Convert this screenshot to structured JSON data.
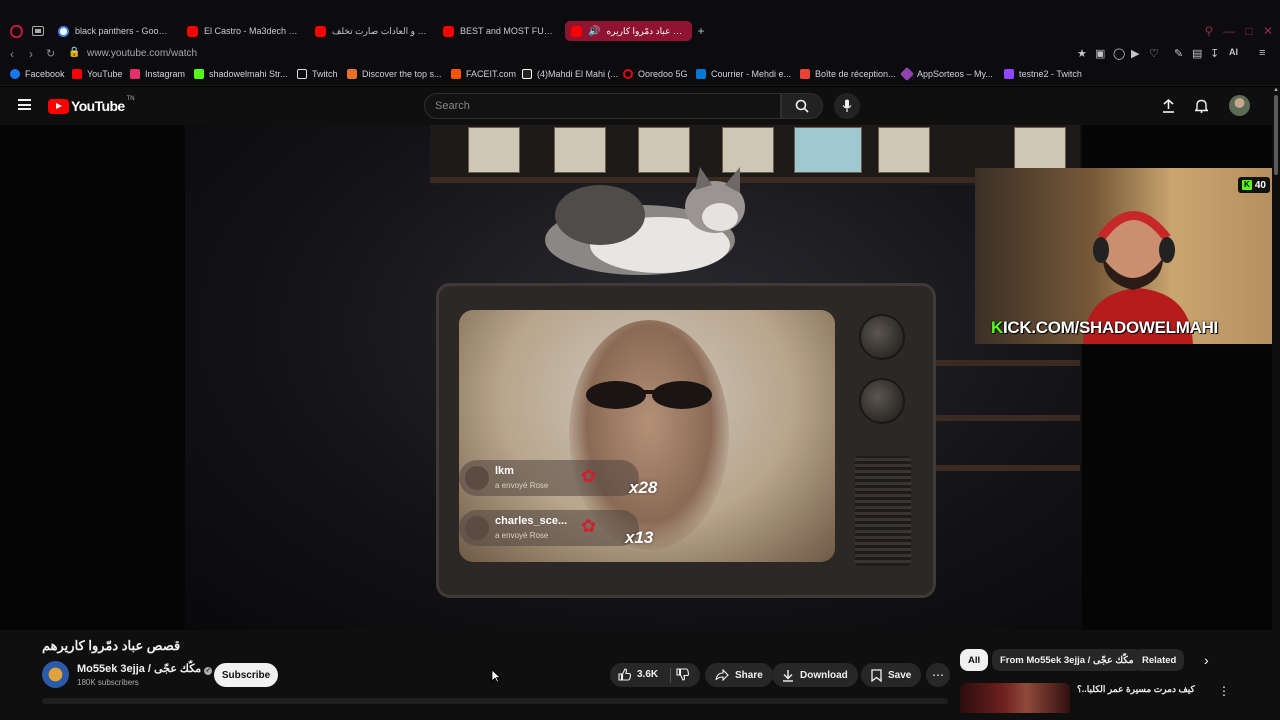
{
  "browser": {
    "tabs": [
      {
        "label": "black panthers - Google S",
        "color": "#4285f4"
      },
      {
        "label": "El Castro - Ma3dech mna",
        "color": "#ff0000"
      },
      {
        "label": "الدين و العادات صارت تخلف",
        "color": "#ff0000"
      },
      {
        "label": "BEST and MOST FUNNY",
        "color": "#ff0000"
      },
      {
        "label": "قصص عباد دمّروا كاريره",
        "color": "#ff0000"
      }
    ],
    "url": "www.youtube.com/watch",
    "bookmarks": [
      {
        "label": "Facebook",
        "color": "#1877f2"
      },
      {
        "label": "YouTube",
        "color": "#ff0000"
      },
      {
        "label": "Instagram",
        "color": "#e1306c"
      },
      {
        "label": "shadowelmahi Str...",
        "color": "#53fc18"
      },
      {
        "label": "Twitch",
        "color": "#9146ff"
      },
      {
        "label": "Discover the top s...",
        "color": "#e8712b"
      },
      {
        "label": "FACEIT.com",
        "color": "#ff5500"
      },
      {
        "label": "(4)Mahdi El Mahi (...",
        "color": "#ffffff"
      },
      {
        "label": "Ooredoo 5G",
        "color": "#e30613"
      },
      {
        "label": "Courrier - Mehdi e...",
        "color": "#0078d4"
      },
      {
        "label": "Boîte de réception...",
        "color": "#ea4335"
      },
      {
        "label": "AppSorteos – My...",
        "color": "#8e44ad"
      },
      {
        "label": "testne2 - Twitch",
        "color": "#9146ff"
      }
    ],
    "ai_label": "AI"
  },
  "youtube": {
    "logo_text": "YouTube",
    "logo_suffix": "TN",
    "search_placeholder": "Search",
    "video": {
      "gifts": [
        {
          "name": "lkm",
          "sub": "a envoyé Rose",
          "count": "x28"
        },
        {
          "name": "charles_sce...",
          "sub": "a envoyé Rose",
          "count": "x13"
        }
      ],
      "cam_badge": "40",
      "kick_prefix": "K",
      "kick_text": "ICK.COM/SHADOWELMAHI"
    },
    "title": "قصص عباد دمّروا كاريرهم",
    "channel": {
      "name": "Mo55ek 3ejja / مكّك عجّى",
      "subscribers": "180K subscribers",
      "subscribe_label": "Subscribe"
    },
    "actions": {
      "likes": "3.6K",
      "share": "Share",
      "download": "Download",
      "save": "Save"
    },
    "chips": [
      "All",
      "From Mo55ek 3ejja / مكّك عجّى",
      "Related"
    ],
    "recommendation_title": "كيف دمرت مسيرة عمر الكلبا..؟"
  }
}
